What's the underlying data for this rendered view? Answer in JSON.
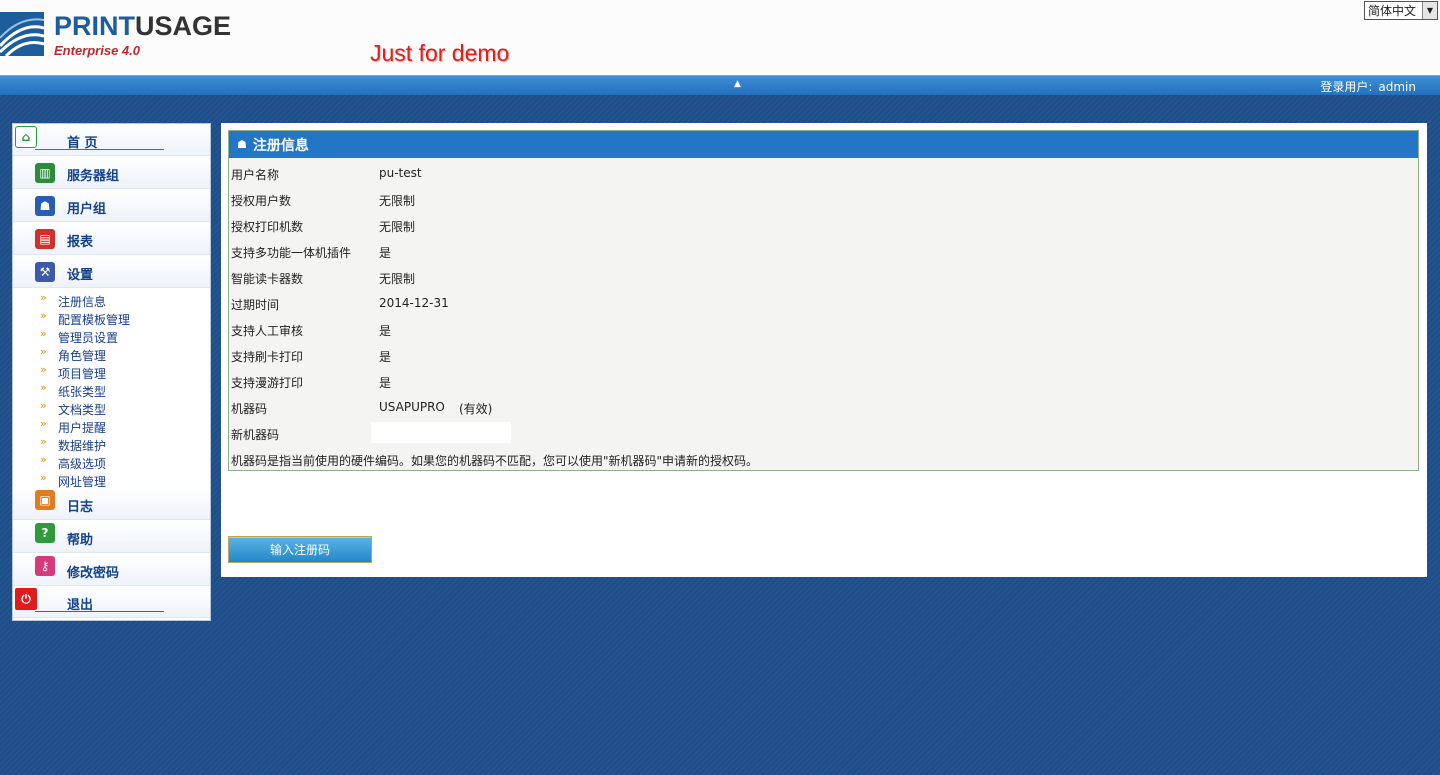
{
  "header": {
    "logo_main_1": "PRINT",
    "logo_main_2": "USAGE",
    "logo_sub": "Enterprise 4.0",
    "demo": "Just for demo",
    "language": "简体中文"
  },
  "topbar": {
    "login_label": "登录用户:",
    "login_user": "admin"
  },
  "sidebar": {
    "items": [
      {
        "label": "首 页",
        "icon": "home-icon"
      },
      {
        "label": "服务器组",
        "icon": "server-group-icon"
      },
      {
        "label": "用户组",
        "icon": "user-group-icon"
      },
      {
        "label": "报表",
        "icon": "report-icon"
      },
      {
        "label": "设置",
        "icon": "settings-icon"
      },
      {
        "label": "日志",
        "icon": "log-icon"
      },
      {
        "label": "帮助",
        "icon": "help-icon"
      },
      {
        "label": "修改密码",
        "icon": "change-password-icon"
      },
      {
        "label": "退出",
        "icon": "logout-icon"
      }
    ],
    "settings_sub": [
      "注册信息",
      "配置模板管理",
      "管理员设置",
      "角色管理",
      "项目管理",
      "纸张类型",
      "文档类型",
      "用户提醒",
      "数据维护",
      "高级选项",
      "网址管理"
    ]
  },
  "panel": {
    "title": "注册信息",
    "rows": [
      {
        "key": "用户名称",
        "value": "pu-test"
      },
      {
        "key": "授权用户数",
        "value": "无限制"
      },
      {
        "key": "授权打印机数",
        "value": "无限制"
      },
      {
        "key": "支持多功能一体机插件",
        "value": "是"
      },
      {
        "key": "智能读卡器数",
        "value": "无限制"
      },
      {
        "key": "过期时间",
        "value": "2014-12-31"
      },
      {
        "key": "支持人工审核",
        "value": "是"
      },
      {
        "key": "支持刷卡打印",
        "value": "是"
      },
      {
        "key": "支持漫游打印",
        "value": "是"
      },
      {
        "key": "机器码",
        "value": "USAPUPRO",
        "status": "(有效)"
      }
    ],
    "new_machine_label": "新机器码",
    "new_machine_value": "",
    "note": "机器码是指当前使用的硬件编码。如果您的机器码不匹配，您可以使用\"新机器码\"申请新的授权码。",
    "register_button": "输入注册码"
  },
  "colors": {
    "accent_blue": "#2376c6",
    "background": "#1f4f8a",
    "demo_red": "#d9231f"
  }
}
